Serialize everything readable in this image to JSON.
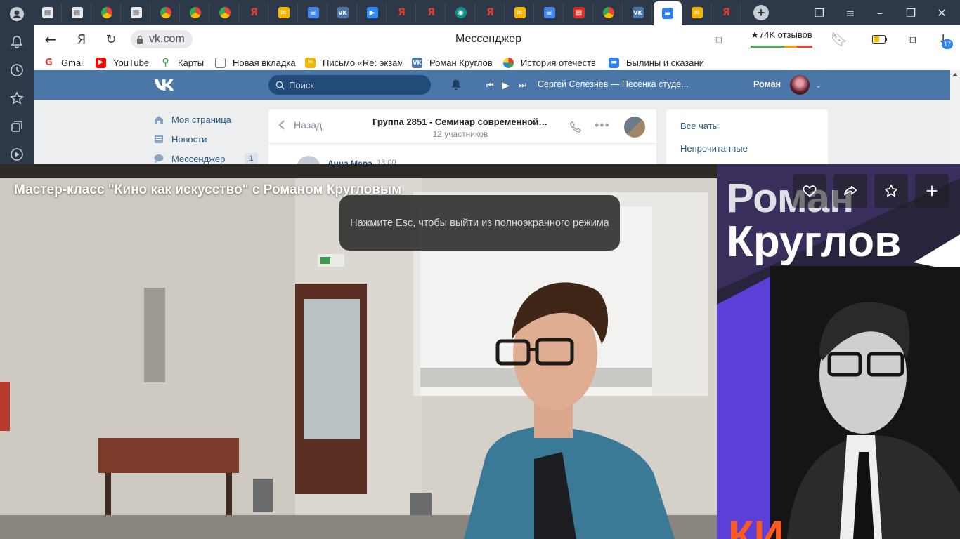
{
  "browser": {
    "tabs_count": 24,
    "active_tab_index": 21,
    "address": "vk.com",
    "page_title": "Мессенджер",
    "reviews": "★74K отзывов",
    "downloads_badge": "17"
  },
  "bookmarks": [
    {
      "label": "Gmail",
      "icon": "gmail-icon",
      "color": "#ea4335"
    },
    {
      "label": "YouTube",
      "icon": "youtube-icon",
      "color": "#ff0000"
    },
    {
      "label": "Карты",
      "icon": "maps-pin-icon",
      "color": "#34a853"
    },
    {
      "label": "Новая вкладка",
      "icon": "page-icon",
      "color": "#ffffff"
    },
    {
      "label": "Письмо «Re: экзам",
      "icon": "mail-icon",
      "color": "#f5b400"
    },
    {
      "label": "Роман Круглов",
      "icon": "vk-icon",
      "color": "#4a76a8"
    },
    {
      "label": "История отечеств",
      "icon": "colorful-icon",
      "color": "#e53935"
    },
    {
      "label": "Былины и сказани",
      "icon": "chat-icon",
      "color": "#2d82f0"
    }
  ],
  "vk": {
    "search_placeholder": "Поиск",
    "now_playing": "Сергей Селезнёв — Песенка студе...",
    "user_name": "Роман",
    "menu": [
      {
        "label": "Моя страница"
      },
      {
        "label": "Новости"
      },
      {
        "label": "Мессенджер",
        "count": "1"
      }
    ],
    "chat": {
      "back_label": "Назад",
      "title": "Группа 2851 - Семинар современной о...",
      "subtitle": "12 участников",
      "first_message_author": "Анна Мера",
      "first_message_time": "18:00"
    },
    "filters": [
      "Все чаты",
      "Непрочитанные"
    ]
  },
  "video": {
    "title": "Мастер-класс \"Кино как искусство\" с Романом Кругловым",
    "toast": "Нажмите Esc, чтобы выйти из полноэкранного режима",
    "poster_first_name": "Роман",
    "poster_last_name": "Круглов",
    "poster_bottom_text": "КИ",
    "accent_purple": "#5b3fd6",
    "accent_orange": "#ff5a1f"
  }
}
